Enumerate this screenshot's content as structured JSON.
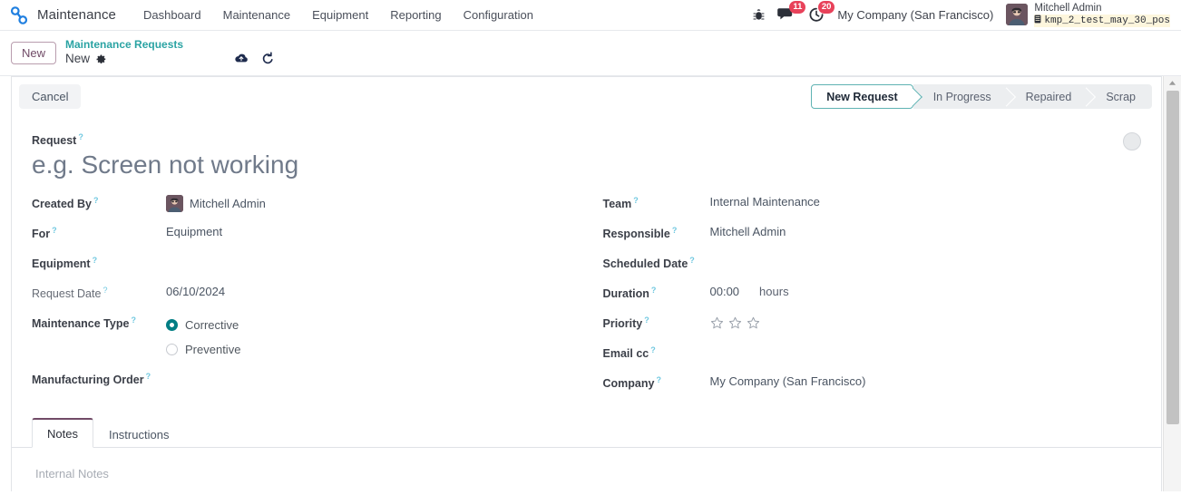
{
  "navbar": {
    "app_icon": "wrench-link-icon",
    "app_name": "Maintenance",
    "menu_items": [
      {
        "label": "Dashboard"
      },
      {
        "label": "Maintenance"
      },
      {
        "label": "Equipment"
      },
      {
        "label": "Reporting"
      },
      {
        "label": "Configuration"
      }
    ],
    "systray": {
      "debug_icon": "bug-icon",
      "messages_icon": "chat-icon",
      "messages_count": "11",
      "activities_icon": "clock-icon",
      "activities_count": "20",
      "company": "My Company (San Francisco)",
      "user_name": "Mitchell Admin",
      "database": "kmp_2_test_may_30_pos",
      "database_icon": "database-icon",
      "avatar": "user-avatar"
    }
  },
  "control_panel": {
    "new_button": "New",
    "breadcrumb_parent": "Maintenance Requests",
    "breadcrumb_current": "New",
    "settings_icon": "gear-icon",
    "save_icon": "cloud-save-icon",
    "discard_icon": "discard-undo-icon"
  },
  "form": {
    "cancel_button": "Cancel",
    "statusbar": [
      {
        "label": "New Request",
        "active": true
      },
      {
        "label": "In Progress",
        "active": false
      },
      {
        "label": "Repaired",
        "active": false
      },
      {
        "label": "Scrap",
        "active": false
      }
    ],
    "kanban_state_icon": "state-circle-icon",
    "title_label": "Request",
    "title_placeholder": "e.g. Screen not working",
    "help_marker": "?",
    "left_fields": [
      {
        "label": "Created By",
        "value": "Mitchell Admin"
      },
      {
        "label": "For",
        "value": "Equipment"
      },
      {
        "label": "Equipment",
        "value": ""
      },
      {
        "label": "Request Date",
        "value": "06/10/2024"
      }
    ],
    "maintenance_type": {
      "label": "Maintenance Type",
      "options": [
        {
          "label": "Corrective",
          "selected": true
        },
        {
          "label": "Preventive",
          "selected": false
        }
      ]
    },
    "manufacturing_order": {
      "label": "Manufacturing Order",
      "value": ""
    },
    "right_fields": [
      {
        "label": "Team",
        "value": "Internal Maintenance"
      },
      {
        "label": "Responsible",
        "value": "Mitchell Admin"
      },
      {
        "label": "Scheduled Date",
        "value": ""
      }
    ],
    "duration": {
      "label": "Duration",
      "value": "00:00",
      "unit": "hours"
    },
    "priority": {
      "label": "Priority",
      "stars": 3,
      "filled": 0
    },
    "email_cc": {
      "label": "Email cc",
      "value": ""
    },
    "company": {
      "label": "Company",
      "value": "My Company (San Francisco)"
    },
    "tabs": [
      {
        "label": "Notes",
        "active": true
      },
      {
        "label": "Instructions",
        "active": false
      }
    ],
    "notes_placeholder": "Internal Notes"
  },
  "colors": {
    "accent_teal": "#017e84",
    "brand_purple": "#714b67",
    "badge_red": "#e8425a",
    "link_teal": "#2aa3a3"
  }
}
